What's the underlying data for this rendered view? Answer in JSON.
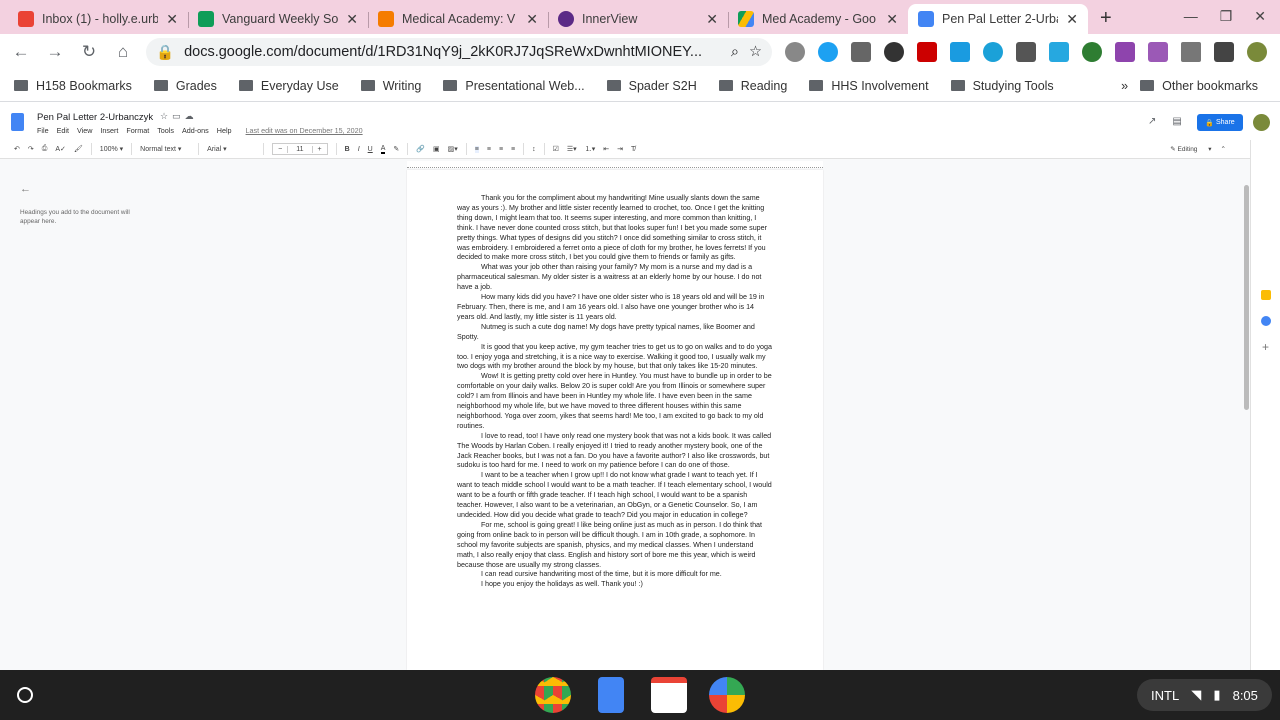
{
  "tabs": [
    {
      "title": "Inbox (1) - holly.e.urb",
      "color": "#ea4335",
      "icon": "gmail-icon"
    },
    {
      "title": "Vanguard Weekly So",
      "color": "#0f9d58",
      "icon": "sheets-icon"
    },
    {
      "title": "Medical Academy: V",
      "color": "#f57c00",
      "icon": "lightbulb-icon"
    },
    {
      "title": "InnerView",
      "color": "#5b2a86",
      "icon": "innerview-icon"
    },
    {
      "title": "Med Academy - Goo",
      "color": "#fbbc04",
      "icon": "drive-icon"
    },
    {
      "title": "Pen Pal Letter 2-Urba",
      "color": "#4285f4",
      "icon": "docs-icon",
      "active": true
    }
  ],
  "url": "docs.google.com/document/d/1RD31NqY9j_2kK0RJ7JqSReWxDwnhtMIONEY...",
  "bookmarks": [
    "H158 Bookmarks",
    "Grades",
    "Everyday Use",
    "Writing",
    "Presentational Web...",
    "Spader S2H",
    "Reading",
    "HHS Involvement",
    "Studying Tools"
  ],
  "other_bookmarks": "Other bookmarks",
  "doc": {
    "title": "Pen Pal Letter 2-Urbanczyk",
    "menu": [
      "File",
      "Edit",
      "View",
      "Insert",
      "Format",
      "Tools",
      "Add-ons",
      "Help"
    ],
    "last_edit": "Last edit was on December 15, 2020",
    "share": "Share",
    "zoom": "100%",
    "style": "Normal text",
    "font": "Arial",
    "font_size": "11",
    "mode": "Editing",
    "outline_hint": "Headings you add to the document will appear here.",
    "paragraphs": [
      "Thank you for the compliment about my handwriting! Mine usually slants down the same way as yours :). My brother and little sister recently learned to crochet, too. Once I get the knitting thing down, I might learn that too. It seems super interesting, and more common than knitting, I think. I have never done counted cross stitch, but that looks super fun! I bet you made some super pretty things. What types of designs did you stitch? I once did something similar to cross stitch, it was embroidery. I embroidered a ferret onto a piece of cloth for my brother, he loves ferrets! If you decided to make more cross stitch, I bet you could give them to friends or family as gifts.",
      "What was your job other than raising your family? My mom is a nurse and my dad is a pharmaceutical salesman. My older sister is a waitress at an elderly home by our house. I do not have a job.",
      "How many kids did you have? I have one older sister who is 18 years old and will be 19 in February. Then, there is me, and I am 16 years old. I also have one younger brother who is 14 years old. And lastly, my little sister is 11 years old.",
      "Nutmeg is such a cute dog name! My dogs have pretty typical names, like Boomer and Spotty.",
      "It is good that you keep active, my gym teacher tries to get us to go on walks and to do yoga too. I enjoy yoga and stretching, it is a nice way to exercise. Walking it good too, I usually walk my two dogs with my brother around the block by my house, but that only takes like 15-20 minutes.",
      "Wow! It is getting pretty cold over here in Huntley. You must have to bundle up in order to be comfortable on your daily walks. Below 20 is super cold! Are you from Illinois or somewhere super cold? I am from Illinois and have been in Huntley my whole life. I have even been in the same neighborhood my whole life, but we have moved to three different houses within this same neighborhood. Yoga over zoom, yikes that seems hard! Me too, I am excited to go back to my old routines.",
      "I love to read, too! I have only read one mystery book that was not a kids book. It was called The Woods by Harlan Coben. I really enjoyed it! I tried to ready another mystery book, one of the Jack Reacher books, but I was not a fan. Do you have a favorite author? I also like crosswords, but sudoku is too hard for me. I need to work on my patience before I can do one of those.",
      "I want to be a teacher when I grow up!! I do not know what grade I want to teach yet. If I want to teach middle school I would want to be a math teacher. If I teach elementary school, I would want to be a fourth or fifth grade teacher. If I teach high school, I would want to be a spanish teacher. However, I also want to be a veterinarian, an ObGyn, or a Genetic Counselor. So, I am undecided. How did you decide what grade to teach? Did you major in education in college?",
      "For me, school is going great! I like being online just as much as in person. I do think that going from online back to in person will be difficult though. I am in 10th grade, a sophomore. In school my favorite subjects are spanish, physics, and my medical classes. When I understand math, I also really enjoy that class. English and history sort of bore me this year, which is weird because those are usually my strong classes.",
      "I can read cursive handwriting most of the time, but it is more difficult for me.",
      "I hope you enjoy the holidays as well. Thank you! :)"
    ]
  },
  "tray": {
    "keyboard": "INTL",
    "time": "8:05"
  }
}
